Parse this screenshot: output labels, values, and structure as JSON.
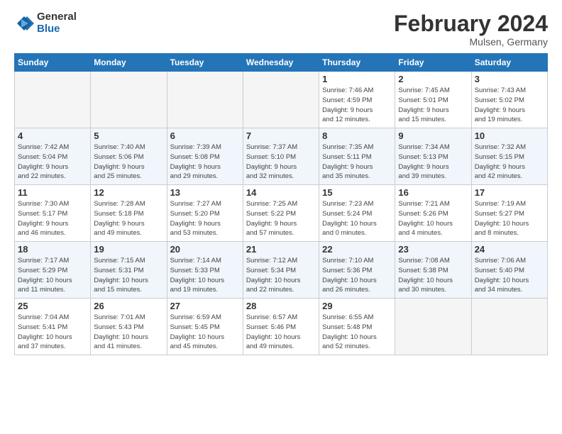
{
  "logo": {
    "general": "General",
    "blue": "Blue"
  },
  "title": "February 2024",
  "subtitle": "Mulsen, Germany",
  "days_header": [
    "Sunday",
    "Monday",
    "Tuesday",
    "Wednesday",
    "Thursday",
    "Friday",
    "Saturday"
  ],
  "weeks": [
    [
      {
        "num": "",
        "info": ""
      },
      {
        "num": "",
        "info": ""
      },
      {
        "num": "",
        "info": ""
      },
      {
        "num": "",
        "info": ""
      },
      {
        "num": "1",
        "info": "Sunrise: 7:46 AM\nSunset: 4:59 PM\nDaylight: 9 hours\nand 12 minutes."
      },
      {
        "num": "2",
        "info": "Sunrise: 7:45 AM\nSunset: 5:01 PM\nDaylight: 9 hours\nand 15 minutes."
      },
      {
        "num": "3",
        "info": "Sunrise: 7:43 AM\nSunset: 5:02 PM\nDaylight: 9 hours\nand 19 minutes."
      }
    ],
    [
      {
        "num": "4",
        "info": "Sunrise: 7:42 AM\nSunset: 5:04 PM\nDaylight: 9 hours\nand 22 minutes."
      },
      {
        "num": "5",
        "info": "Sunrise: 7:40 AM\nSunset: 5:06 PM\nDaylight: 9 hours\nand 25 minutes."
      },
      {
        "num": "6",
        "info": "Sunrise: 7:39 AM\nSunset: 5:08 PM\nDaylight: 9 hours\nand 29 minutes."
      },
      {
        "num": "7",
        "info": "Sunrise: 7:37 AM\nSunset: 5:10 PM\nDaylight: 9 hours\nand 32 minutes."
      },
      {
        "num": "8",
        "info": "Sunrise: 7:35 AM\nSunset: 5:11 PM\nDaylight: 9 hours\nand 35 minutes."
      },
      {
        "num": "9",
        "info": "Sunrise: 7:34 AM\nSunset: 5:13 PM\nDaylight: 9 hours\nand 39 minutes."
      },
      {
        "num": "10",
        "info": "Sunrise: 7:32 AM\nSunset: 5:15 PM\nDaylight: 9 hours\nand 42 minutes."
      }
    ],
    [
      {
        "num": "11",
        "info": "Sunrise: 7:30 AM\nSunset: 5:17 PM\nDaylight: 9 hours\nand 46 minutes."
      },
      {
        "num": "12",
        "info": "Sunrise: 7:28 AM\nSunset: 5:18 PM\nDaylight: 9 hours\nand 49 minutes."
      },
      {
        "num": "13",
        "info": "Sunrise: 7:27 AM\nSunset: 5:20 PM\nDaylight: 9 hours\nand 53 minutes."
      },
      {
        "num": "14",
        "info": "Sunrise: 7:25 AM\nSunset: 5:22 PM\nDaylight: 9 hours\nand 57 minutes."
      },
      {
        "num": "15",
        "info": "Sunrise: 7:23 AM\nSunset: 5:24 PM\nDaylight: 10 hours\nand 0 minutes."
      },
      {
        "num": "16",
        "info": "Sunrise: 7:21 AM\nSunset: 5:26 PM\nDaylight: 10 hours\nand 4 minutes."
      },
      {
        "num": "17",
        "info": "Sunrise: 7:19 AM\nSunset: 5:27 PM\nDaylight: 10 hours\nand 8 minutes."
      }
    ],
    [
      {
        "num": "18",
        "info": "Sunrise: 7:17 AM\nSunset: 5:29 PM\nDaylight: 10 hours\nand 11 minutes."
      },
      {
        "num": "19",
        "info": "Sunrise: 7:15 AM\nSunset: 5:31 PM\nDaylight: 10 hours\nand 15 minutes."
      },
      {
        "num": "20",
        "info": "Sunrise: 7:14 AM\nSunset: 5:33 PM\nDaylight: 10 hours\nand 19 minutes."
      },
      {
        "num": "21",
        "info": "Sunrise: 7:12 AM\nSunset: 5:34 PM\nDaylight: 10 hours\nand 22 minutes."
      },
      {
        "num": "22",
        "info": "Sunrise: 7:10 AM\nSunset: 5:36 PM\nDaylight: 10 hours\nand 26 minutes."
      },
      {
        "num": "23",
        "info": "Sunrise: 7:08 AM\nSunset: 5:38 PM\nDaylight: 10 hours\nand 30 minutes."
      },
      {
        "num": "24",
        "info": "Sunrise: 7:06 AM\nSunset: 5:40 PM\nDaylight: 10 hours\nand 34 minutes."
      }
    ],
    [
      {
        "num": "25",
        "info": "Sunrise: 7:04 AM\nSunset: 5:41 PM\nDaylight: 10 hours\nand 37 minutes."
      },
      {
        "num": "26",
        "info": "Sunrise: 7:01 AM\nSunset: 5:43 PM\nDaylight: 10 hours\nand 41 minutes."
      },
      {
        "num": "27",
        "info": "Sunrise: 6:59 AM\nSunset: 5:45 PM\nDaylight: 10 hours\nand 45 minutes."
      },
      {
        "num": "28",
        "info": "Sunrise: 6:57 AM\nSunset: 5:46 PM\nDaylight: 10 hours\nand 49 minutes."
      },
      {
        "num": "29",
        "info": "Sunrise: 6:55 AM\nSunset: 5:48 PM\nDaylight: 10 hours\nand 52 minutes."
      },
      {
        "num": "",
        "info": ""
      },
      {
        "num": "",
        "info": ""
      }
    ]
  ]
}
